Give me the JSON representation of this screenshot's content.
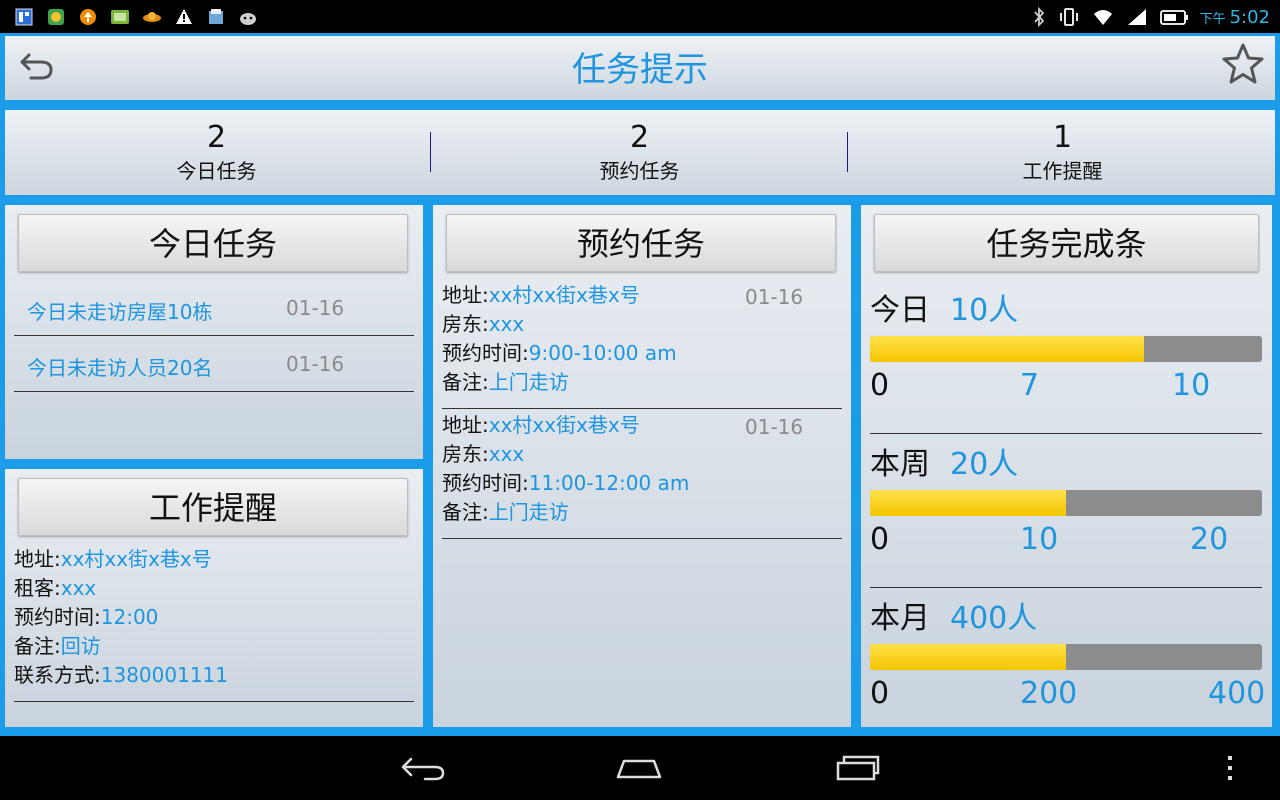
{
  "status_bar": {
    "notification_icons": [
      "gallery-icon",
      "browser-icon",
      "upload-icon",
      "app-icon",
      "weather-icon",
      "warning-icon",
      "storage-icon",
      "android-icon"
    ],
    "system_icons": [
      "bluetooth-icon",
      "vibrate-icon",
      "wifi-icon",
      "signal-icon",
      "battery-icon"
    ],
    "time_prefix": "下午",
    "time": "5:02"
  },
  "header": {
    "title": "任务提示",
    "back_icon": "back-arrow-icon",
    "favorite_icon": "star-icon"
  },
  "summary": [
    {
      "count": "2",
      "label": "今日任务"
    },
    {
      "count": "2",
      "label": "预约任务"
    },
    {
      "count": "1",
      "label": "工作提醒"
    }
  ],
  "today_tasks": {
    "title": "今日任务",
    "items": [
      {
        "text": "今日未走访房屋10栋",
        "date": "01-16"
      },
      {
        "text": "今日未走访人员20名",
        "date": "01-16"
      }
    ]
  },
  "work_reminder": {
    "title": "工作提醒",
    "fields": [
      {
        "label": "地址:",
        "value": "xx村xx街x巷x号"
      },
      {
        "label": "租客:",
        "value": "xxx"
      },
      {
        "label": "预约时间:",
        "value": "12:00"
      },
      {
        "label": "备注:",
        "value": "回访"
      },
      {
        "label": "联系方式:",
        "value": "1380001111"
      }
    ]
  },
  "appointments": {
    "title": "预约任务",
    "items": [
      {
        "date": "01-16",
        "fields": [
          {
            "label": "地址:",
            "value": "xx村xx街x巷x号"
          },
          {
            "label": "房东:",
            "value": "xxx"
          },
          {
            "label": "预约时间:",
            "value": "9:00-10:00 am"
          },
          {
            "label": "备注:",
            "value": "上门走访"
          }
        ]
      },
      {
        "date": "01-16",
        "fields": [
          {
            "label": "地址:",
            "value": "xx村xx街x巷x号"
          },
          {
            "label": "房东:",
            "value": "xxx"
          },
          {
            "label": "预约时间:",
            "value": "11:00-12:00 am"
          },
          {
            "label": "备注:",
            "value": "上门走访"
          }
        ]
      }
    ]
  },
  "progress": {
    "title": "任务完成条",
    "bars": [
      {
        "label": "今日",
        "value_text": "10人",
        "min": "0",
        "mid": "7",
        "max": "10",
        "fill_fraction": 0.7
      },
      {
        "label": "本周",
        "value_text": "20人",
        "min": "0",
        "mid": "10",
        "max": "20",
        "fill_fraction": 0.5
      },
      {
        "label": "本月",
        "value_text": "400人",
        "min": "0",
        "mid": "200",
        "max": "400",
        "fill_fraction": 0.5
      }
    ],
    "fill_color": "#f4c400",
    "track_color": "#8c8c8c"
  },
  "nav_bar": {
    "buttons": [
      "back-icon",
      "home-icon",
      "recent-apps-icon"
    ],
    "menu_icon": "overflow-menu-icon"
  },
  "colors": {
    "accent": "#1e95de",
    "frame": "#1a9ce8"
  }
}
